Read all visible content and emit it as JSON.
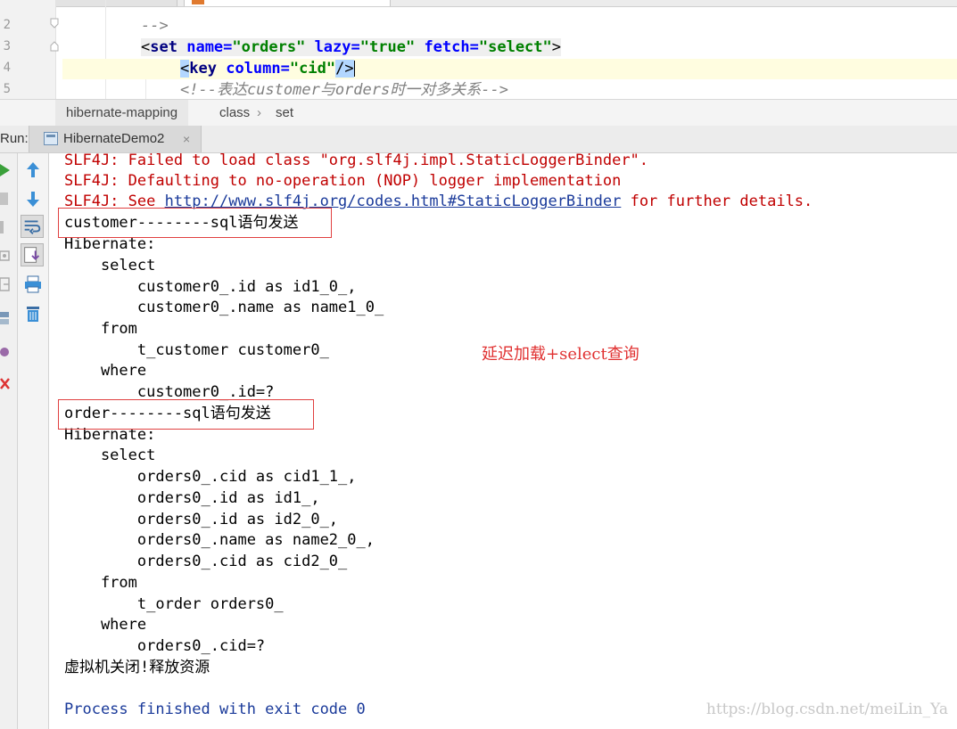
{
  "editor": {
    "line_numbers": [
      "2",
      "3",
      "4",
      "5"
    ],
    "lines": [
      {
        "comment_end": "-->"
      },
      {
        "open": "<",
        "tag": "set",
        "attr1": "name",
        "eq": "=",
        "val1": "\"orders\"",
        "attr2": "lazy",
        "val2": "\"true\"",
        "attr3": "fetch",
        "val3": "\"select\"",
        "close": ">"
      },
      {
        "open": "<",
        "tag": "key",
        "attr1": "column",
        "eq": "=",
        "val1": "\"cid\"",
        "close": "/>"
      },
      {
        "comment": "<!--表达customer与orders时一对多关系-->"
      }
    ]
  },
  "breadcrumb": {
    "items": [
      "hibernate-mapping",
      "class",
      "set"
    ],
    "separator": "›"
  },
  "run": {
    "label": "Run:",
    "tab_name": "HibernateDemo2",
    "close_glyph": "×"
  },
  "console": {
    "slf4j_1": "SLF4J: Failed to load class \"org.slf4j.impl.StaticLoggerBinder\".",
    "slf4j_2": "SLF4J: Defaulting to no-operation (NOP) logger implementation",
    "slf4j_3_prefix": "SLF4J: See ",
    "slf4j_3_link": "http://www.slf4j.org/codes.html#StaticLoggerBinder",
    "slf4j_3_suffix": " for further details.",
    "lines": [
      "customer--------sql语句发送",
      "Hibernate:",
      "    select",
      "        customer0_.id as id1_0_,",
      "        customer0_.name as name1_0_",
      "    from",
      "        t_customer customer0_",
      "    where",
      "        customer0_.id=?",
      "order--------sql语句发送",
      "Hibernate:",
      "    select",
      "        orders0_.cid as cid1_1_,",
      "        orders0_.id as id1_,",
      "        orders0_.id as id2_0_,",
      "        orders0_.name as name2_0_,",
      "        orders0_.cid as cid2_0_",
      "    from",
      "        t_order orders0_",
      "    where",
      "        orders0_.cid=?",
      "虚拟机关闭!释放资源",
      "",
      "Process finished with exit code 0"
    ],
    "annotation": "延迟加载+select查询"
  },
  "watermark": "https://blog.csdn.net/meiLin_Ya",
  "colors": {
    "error_text": "#c00000",
    "annotation": "#e03030",
    "box_border": "#e04040",
    "xml_tag": "#000080",
    "xml_attr": "#0000ff",
    "xml_value": "#008000"
  },
  "icons": {
    "side_strip": [
      "run-icon",
      "stop-icon",
      "pause-icon",
      "camera-icon",
      "exit-icon",
      "layout-icon",
      "pin-icon",
      "close-icon"
    ],
    "toolbar": [
      "up-arrow-icon",
      "down-arrow-icon",
      "soft-wrap-icon",
      "scroll-to-end-icon",
      "print-icon",
      "trash-icon"
    ]
  }
}
